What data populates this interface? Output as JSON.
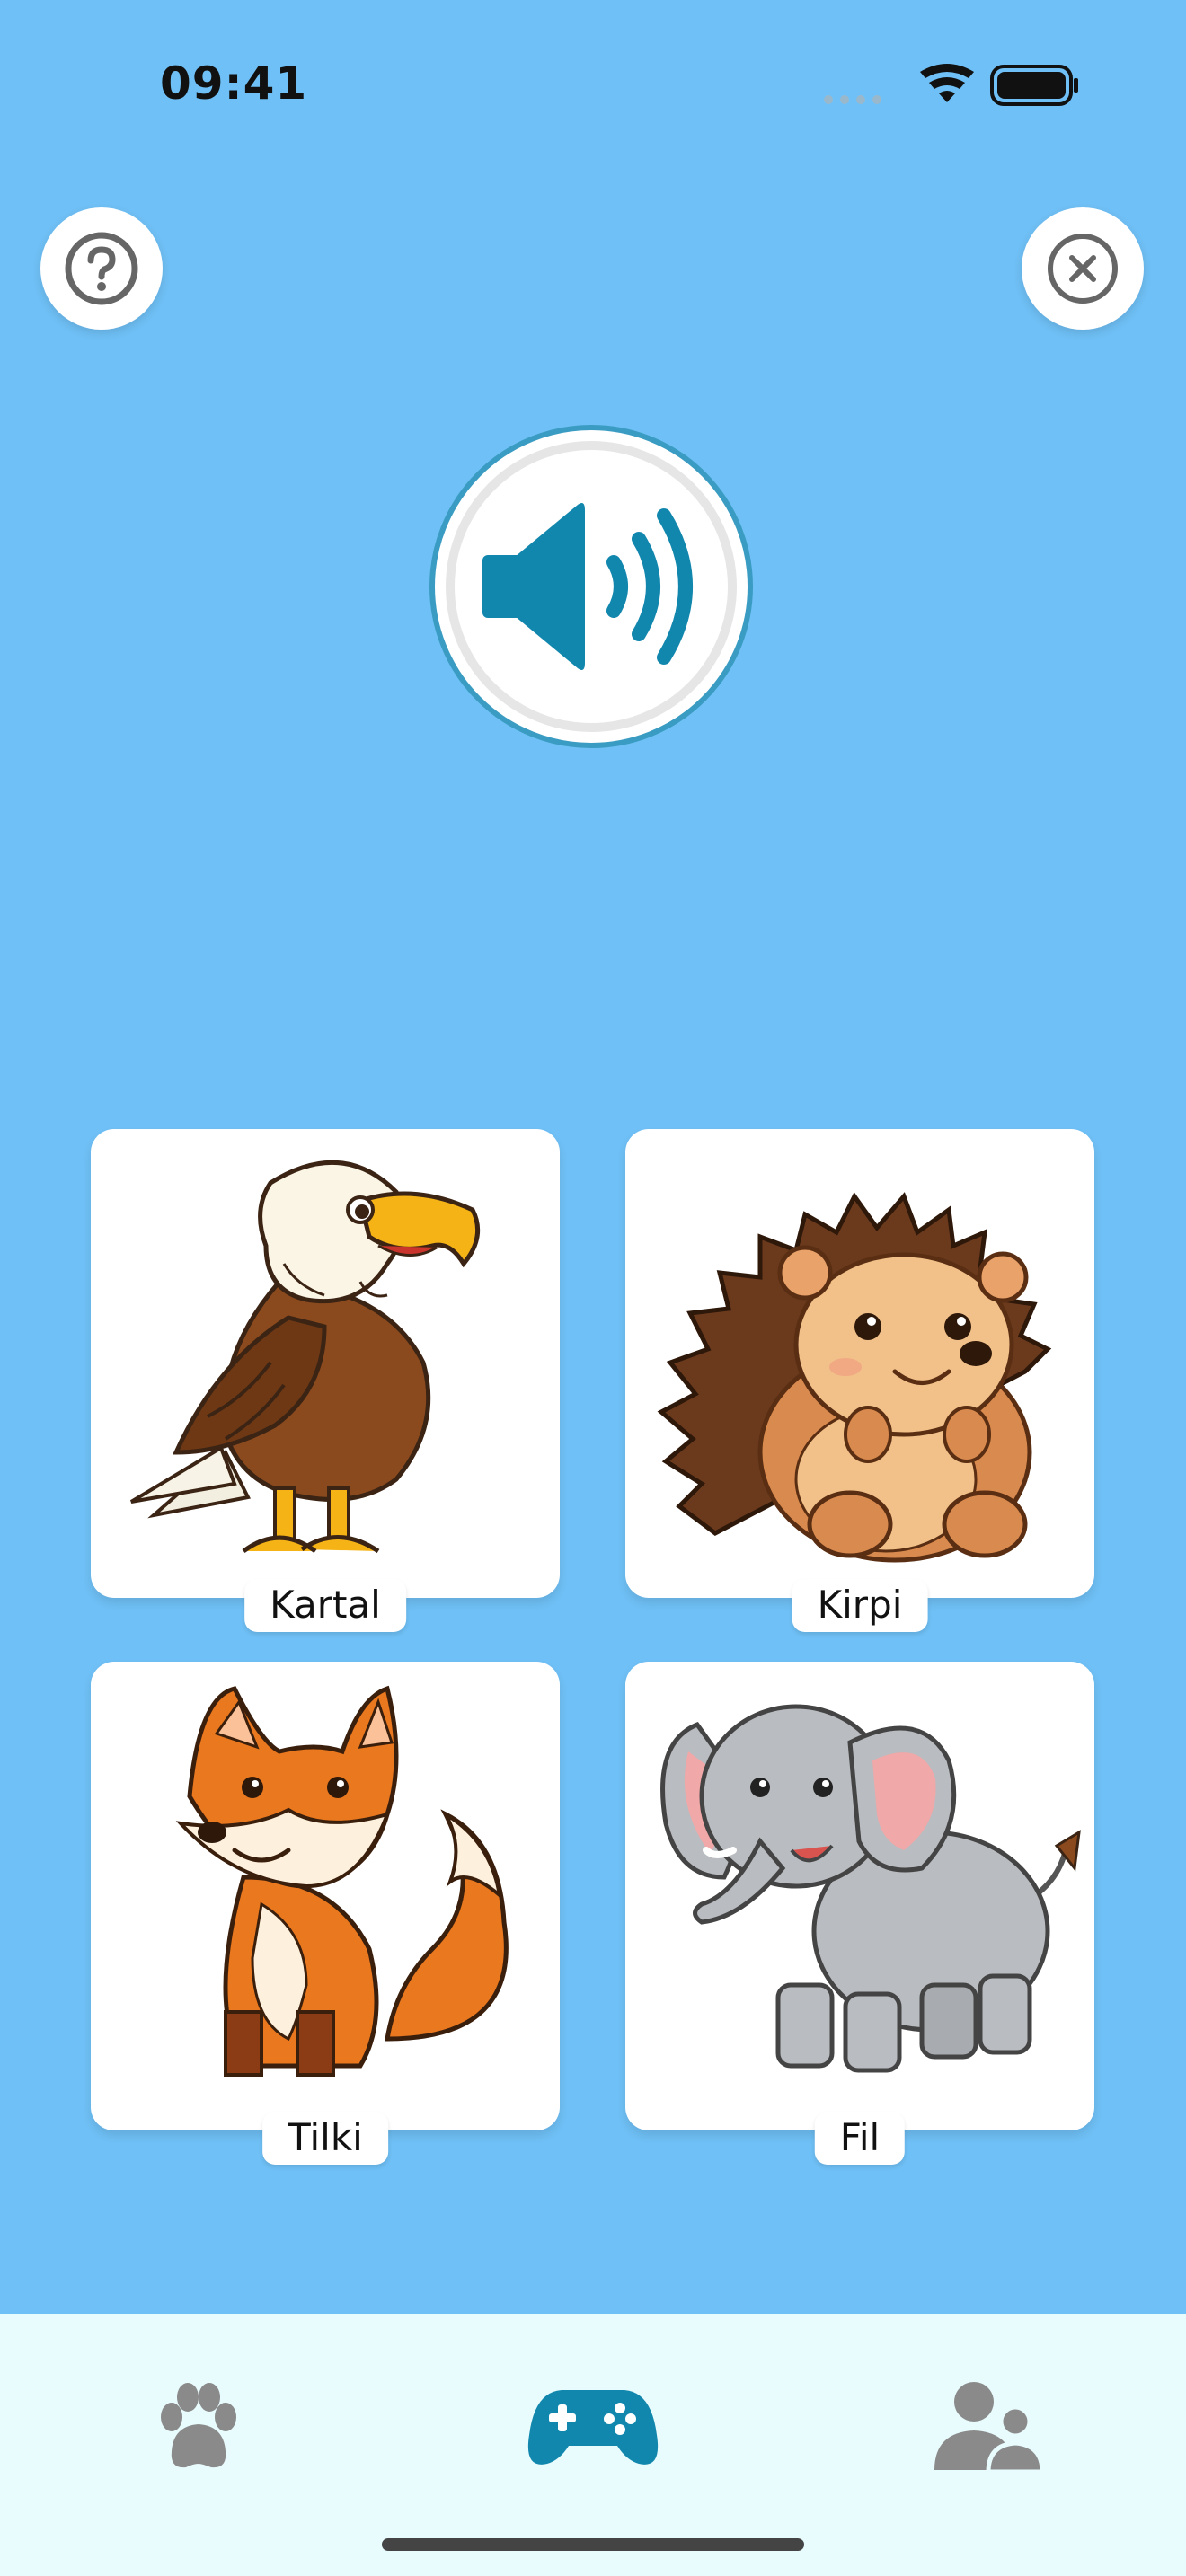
{
  "status_bar": {
    "time": "09:41"
  },
  "top_buttons": {
    "help_icon": "question-circle-icon",
    "close_icon": "x-circle-icon"
  },
  "speaker": {
    "icon": "speaker-volume-icon",
    "color": "#1287ae"
  },
  "cards": [
    {
      "label": "Kartal",
      "image": "eagle"
    },
    {
      "label": "Kirpi",
      "image": "hedgehog"
    },
    {
      "label": "Tilki",
      "image": "fox"
    },
    {
      "label": "Fil",
      "image": "elephant"
    }
  ],
  "tabs": [
    {
      "icon": "paw-icon",
      "active": false
    },
    {
      "icon": "gamepad-icon",
      "active": true
    },
    {
      "icon": "users-icon",
      "active": false
    }
  ],
  "colors": {
    "background": "#6fc0f6",
    "accent": "#1287ae",
    "inactive": "#8a8a8a",
    "tab_bar": "#e8fbfd"
  }
}
